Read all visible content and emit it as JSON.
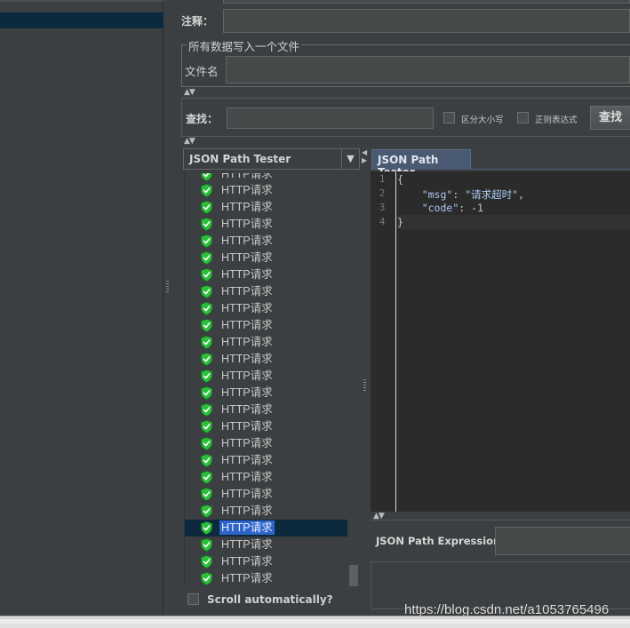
{
  "form": {
    "comment_label": "注释：",
    "write_all_legend": "所有数据写入一个文件",
    "filename_label": "文件名",
    "search_label": "查找：",
    "case_sensitive_label": "区分大小写",
    "regex_label": "正则表达式",
    "search_button": "查找"
  },
  "renderer": {
    "selected": "JSON Path Tester",
    "dropdown_arrow": "▼"
  },
  "results": {
    "partial_top_item": "HTTP请求",
    "items": [
      "HTTP请求",
      "HTTP请求",
      "HTTP请求",
      "HTTP请求",
      "HTTP请求",
      "HTTP请求",
      "HTTP请求",
      "HTTP请求",
      "HTTP请求",
      "HTTP请求",
      "HTTP请求",
      "HTTP请求",
      "HTTP请求",
      "HTTP请求",
      "HTTP请求",
      "HTTP请求",
      "HTTP请求",
      "HTTP请求",
      "HTTP请求",
      "HTTP请求",
      "HTTP请求",
      "HTTP请求",
      "HTTP请求",
      "HTTP请求"
    ],
    "selected_index": 20,
    "status_icon": "green-shield-check-icon",
    "scroll_auto_label": "Scroll automatically?"
  },
  "tester": {
    "tab_label": "JSON Path Tester",
    "line_numbers": [
      "1",
      "2",
      "3",
      "4"
    ],
    "code_lines": [
      "{",
      "    \"msg\": \"请求超时\",",
      "    \"code\": -1",
      "}"
    ],
    "expression_label": "JSON Path Expression"
  },
  "watermark": "https://blog.csdn.net/a1053765496",
  "colors": {
    "background": "#3c3f41",
    "editor_bg": "#2b2b2b",
    "selection": "#2f65ca",
    "tab_active": "#4a5a72",
    "success_green": "#2dbe3c"
  }
}
